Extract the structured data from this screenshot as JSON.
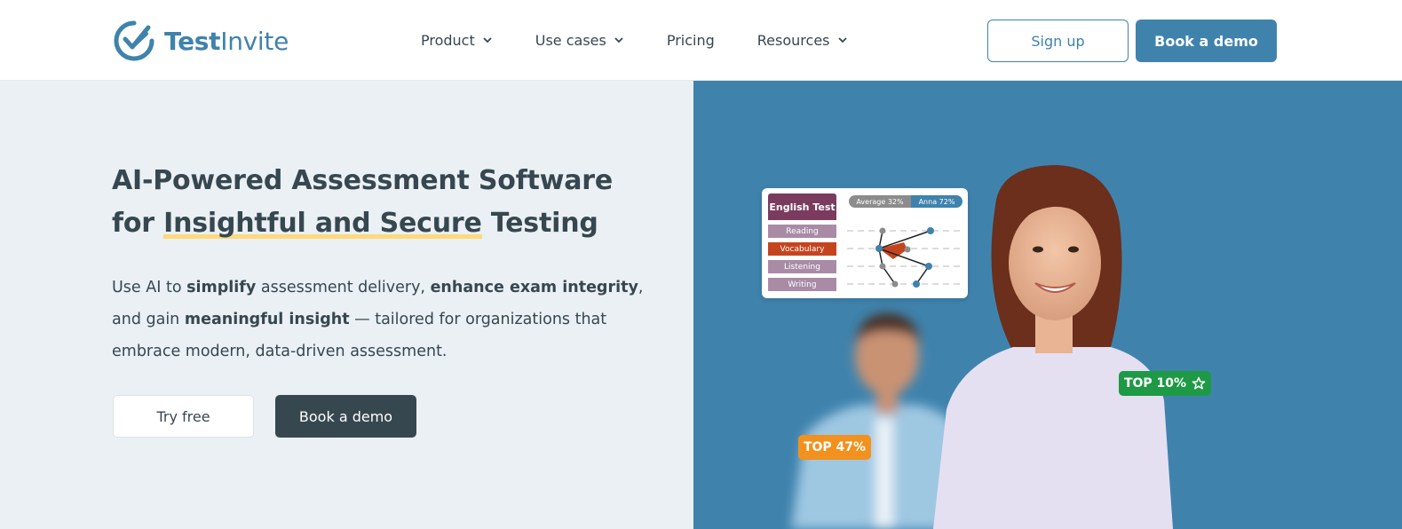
{
  "brand": {
    "name_bold": "Test",
    "name_thin": "Invite",
    "logo_icon": "check-circle-logo-icon",
    "accent_color": "#3f83ad",
    "dark_color": "#37474f"
  },
  "nav": {
    "items": [
      {
        "label": "Product",
        "has_dropdown": true
      },
      {
        "label": "Use cases",
        "has_dropdown": true
      },
      {
        "label": "Pricing",
        "has_dropdown": false
      },
      {
        "label": "Resources",
        "has_dropdown": true
      }
    ],
    "signup_label": "Sign up",
    "demo_label": "Book a demo"
  },
  "hero": {
    "title_line1": "AI-Powered Assessment Software",
    "title_for": "for ",
    "title_highlight": "Insightful and Secure",
    "title_end": " Testing",
    "sub_1": "Use AI to ",
    "sub_b1": "simplify",
    "sub_2": " assessment delivery, ",
    "sub_b2": "enhance exam integrity",
    "sub_3": ",",
    "sub_4": "and gain ",
    "sub_b3": "meaningful insight",
    "sub_5": " — tailored for organizations that",
    "sub_6": "embrace modern, data-driven assessment.",
    "try_label": "Try free",
    "demo_label": "Book a demo"
  },
  "illustration": {
    "card": {
      "title": "English Test",
      "rows": [
        "Reading",
        "Vocabulary",
        "Listening",
        "Writing"
      ],
      "active_row": "Vocabulary",
      "avg_label": "Average",
      "avg_value": "32%",
      "anna_label": "Anna",
      "anna_value": "72%"
    },
    "badge_top10": "TOP 10%",
    "badge_top47": "TOP 47%",
    "colors": {
      "top10": "#1e9a46",
      "top47": "#f2911d",
      "card_header": "#7a3b5e",
      "active_row": "#c5441e"
    }
  }
}
